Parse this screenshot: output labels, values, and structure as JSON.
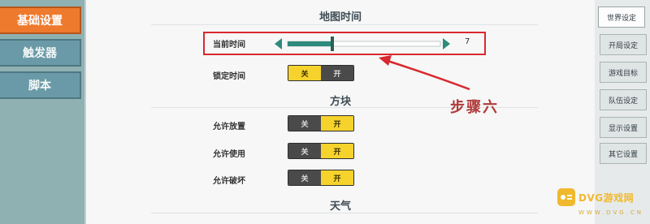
{
  "left_tabs": [
    {
      "label": "基础设置",
      "active": true
    },
    {
      "label": "触发器",
      "active": false
    },
    {
      "label": "脚本",
      "active": false
    }
  ],
  "sections": {
    "map_time": "地图时间",
    "blocks": "方块",
    "weather": "天气"
  },
  "current_time": {
    "label": "当前时间",
    "value": "7",
    "slider_fraction": 0.29
  },
  "lock_time": {
    "label": "锁定时间",
    "off": "关",
    "on": "开",
    "state": "off"
  },
  "block_rows": [
    {
      "label": "允许放置",
      "off": "关",
      "on": "开",
      "state": "on"
    },
    {
      "label": "允许使用",
      "off": "关",
      "on": "开",
      "state": "on"
    },
    {
      "label": "允许破坏",
      "off": "关",
      "on": "开",
      "state": "on"
    }
  ],
  "right_tabs": [
    {
      "label": "世界设定",
      "active": true
    },
    {
      "label": "开局设定",
      "active": false
    },
    {
      "label": "游戏目标",
      "active": false
    },
    {
      "label": "队伍设定",
      "active": false
    },
    {
      "label": "显示设置",
      "active": false
    },
    {
      "label": "其它设置",
      "active": false
    }
  ],
  "annotation": "步骤六",
  "watermark": {
    "brand": "DVG游戏网",
    "sub": "WWW.DVG.CN"
  },
  "colors": {
    "accent_orange": "#ee7a2e",
    "toggle_yellow": "#f6d32c",
    "highlight_red": "#d9282f",
    "slider_teal": "#2e8a7c"
  }
}
